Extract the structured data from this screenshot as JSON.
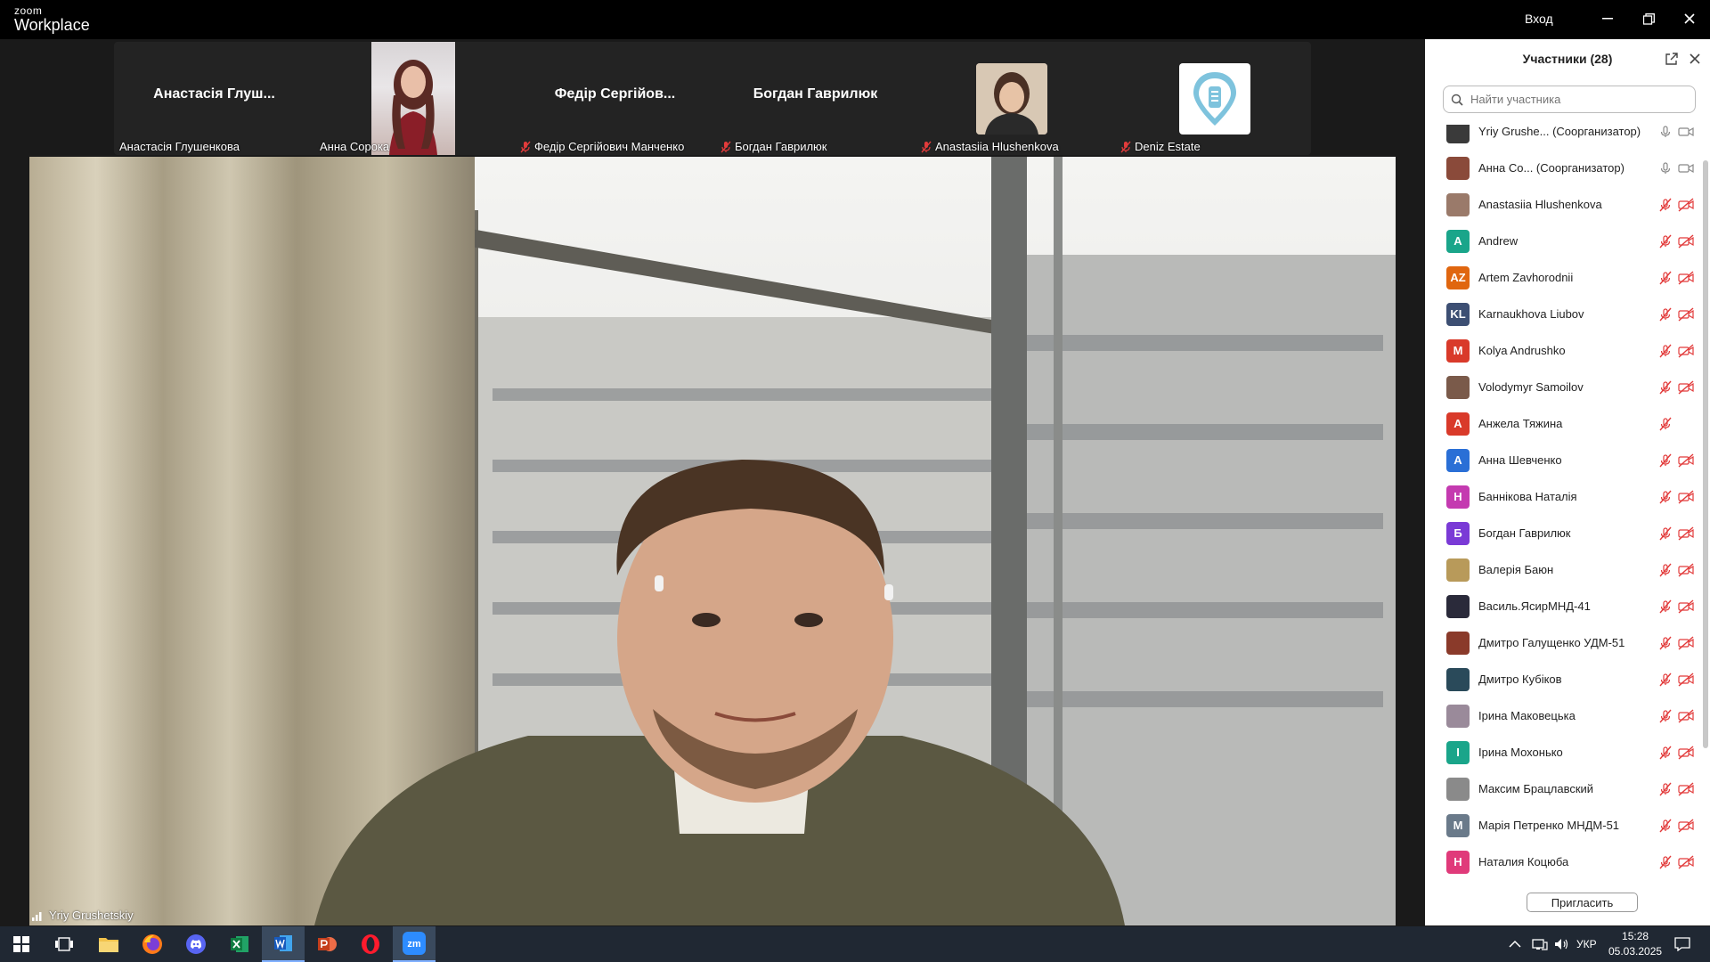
{
  "app": {
    "brand_top": "zoom",
    "brand_bottom": "Workplace",
    "signin_label": "Вход"
  },
  "gallery": [
    {
      "center_name": "Анастасія Глуш...",
      "footer_name": "Анастасія Глушенкова",
      "muted": false,
      "kind": "name"
    },
    {
      "center_name": "",
      "footer_name": "Анна Сорока",
      "muted": false,
      "kind": "video"
    },
    {
      "center_name": "Федір Сергійов...",
      "footer_name": "Федір Сергійович Манченко",
      "muted": true,
      "kind": "name"
    },
    {
      "center_name": "Богдан Гаврилюк",
      "footer_name": "Богдан Гаврилюк",
      "muted": true,
      "kind": "name"
    },
    {
      "center_name": "",
      "footer_name": "Anastasiia Hlushenkova",
      "muted": true,
      "kind": "photo"
    },
    {
      "center_name": "",
      "footer_name": "Deniz Estate",
      "muted": true,
      "kind": "logo"
    }
  ],
  "main_video": {
    "speaker_name": "Yriy Grushetskiy"
  },
  "panel": {
    "title": "Участники (28)",
    "search_placeholder": "Найти участника",
    "invite_label": "Пригласить",
    "participants": [
      {
        "name": "Yriy Grushe... (Соорганизатор)",
        "initials": "",
        "color": "#3a3a3a",
        "mic": "on",
        "cam": "on"
      },
      {
        "name": "Анна Со... (Соорганизатор)",
        "initials": "",
        "color": "#8a4a3a",
        "mic": "on",
        "cam": "on"
      },
      {
        "name": "Anastasiia Hlushenkova",
        "initials": "",
        "color": "#9a7a6a",
        "mic": "off",
        "cam": "off"
      },
      {
        "name": "Andrew",
        "initials": "A",
        "color": "#1aa58a",
        "mic": "off",
        "cam": "off"
      },
      {
        "name": "Artem Zavhorodnii",
        "initials": "AZ",
        "color": "#e0660f",
        "mic": "off",
        "cam": "off"
      },
      {
        "name": "Karnaukhova Liubov",
        "initials": "KL",
        "color": "#3d4f73",
        "mic": "off",
        "cam": "off"
      },
      {
        "name": "Kolya Andrushko",
        "initials": "M",
        "color": "#d93a2a",
        "mic": "off",
        "cam": "off"
      },
      {
        "name": "Volodymyr Samoilov",
        "initials": "",
        "color": "#7a5a4a",
        "mic": "off",
        "cam": "off"
      },
      {
        "name": "Анжела Тяжина",
        "initials": "A",
        "color": "#d93a2a",
        "mic": "off",
        "cam": "none"
      },
      {
        "name": "Анна Шевченко",
        "initials": "A",
        "color": "#2a6fd6",
        "mic": "off",
        "cam": "off"
      },
      {
        "name": "Баннікова Наталія",
        "initials": "Н",
        "color": "#c43ab0",
        "mic": "off",
        "cam": "off"
      },
      {
        "name": "Богдан Гаврилюк",
        "initials": "Б",
        "color": "#7a3ad6",
        "mic": "off",
        "cam": "off"
      },
      {
        "name": "Валерія Баюн",
        "initials": "",
        "color": "#b89a5a",
        "mic": "off",
        "cam": "off"
      },
      {
        "name": "Василь.ЯсирМНД-41",
        "initials": "",
        "color": "#2a2a3a",
        "mic": "off",
        "cam": "off"
      },
      {
        "name": "Дмитро Галущенко УДМ-51",
        "initials": "",
        "color": "#8a3a2a",
        "mic": "off",
        "cam": "off"
      },
      {
        "name": "Дмитро Кубіков",
        "initials": "",
        "color": "#2a4a5a",
        "mic": "off",
        "cam": "off"
      },
      {
        "name": "Ірина Маковецька",
        "initials": "",
        "color": "#9a8a9a",
        "mic": "off",
        "cam": "off"
      },
      {
        "name": "Ірина Мохонько",
        "initials": "I",
        "color": "#1aa58a",
        "mic": "off",
        "cam": "off"
      },
      {
        "name": "Максим Брацлавский",
        "initials": "",
        "color": "#8a8a8a",
        "mic": "off",
        "cam": "off"
      },
      {
        "name": "Марія Петренко МНДМ-51",
        "initials": "M",
        "color": "#6a7a8a",
        "mic": "off",
        "cam": "off"
      },
      {
        "name": "Наталия Коцюба",
        "initials": "Н",
        "color": "#e03a7a",
        "mic": "off",
        "cam": "off"
      }
    ]
  },
  "taskbar": {
    "apps": [
      "start-icon",
      "task-view-icon",
      "file-explorer-icon",
      "firefox-icon",
      "discord-icon",
      "excel-icon",
      "word-icon",
      "powerpoint-icon",
      "opera-icon",
      "zoom-icon"
    ],
    "language": "УКР",
    "time": "15:28",
    "date": "05.03.2025"
  }
}
